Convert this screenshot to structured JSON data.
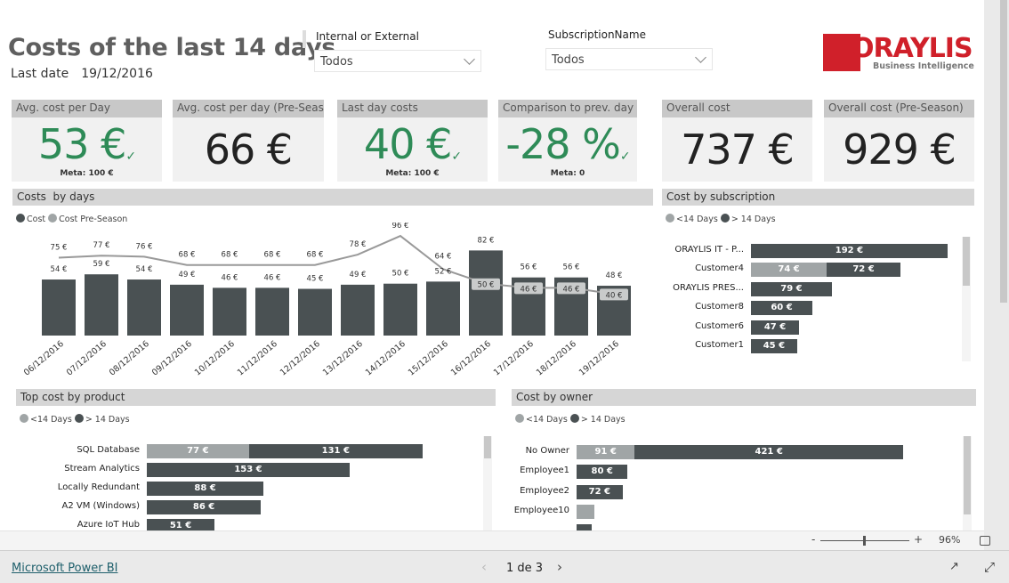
{
  "header": {
    "title": "Costs of the last 14 days",
    "last_date_label": "Last date",
    "last_date_value": "19/12/2016"
  },
  "slicers": [
    {
      "label": "Internal or External",
      "value": "Todos"
    },
    {
      "label": "SubscriptionName",
      "value": "Todos"
    }
  ],
  "logo": {
    "name": "ORAYLIS",
    "tagline": "Business Intelligence",
    "color": "#d0202a"
  },
  "kpis": [
    {
      "title": "Avg. cost per Day",
      "value": "53 €",
      "meta": "Meta: 100 €",
      "status": "good"
    },
    {
      "title": "Avg. cost per day (Pre-Season)",
      "value": "66 €"
    },
    {
      "title": "Last day costs",
      "value": "40 €",
      "meta": "Meta: 100 €",
      "status": "good"
    },
    {
      "title": "Comparison to prev. day",
      "value": "-28 %",
      "meta": "Meta: 0",
      "status": "good"
    },
    {
      "title": "Overall cost",
      "value": "737 €"
    },
    {
      "title": "Overall cost (Pre-Season)",
      "value": "929 €"
    }
  ],
  "colors": {
    "dark": "#4a5153",
    "light": "#a0a5a6",
    "good": "#2e8b57",
    "line": "#999999"
  },
  "chart_data": [
    {
      "type": "bar",
      "title": "Costs  by days",
      "legend": [
        "Cost",
        "Cost Pre-Season"
      ],
      "categories": [
        "06/12/2016",
        "07/12/2016",
        "08/12/2016",
        "09/12/2016",
        "10/12/2016",
        "11/12/2016",
        "12/12/2016",
        "13/12/2016",
        "14/12/2016",
        "15/12/2016",
        "16/12/2016",
        "17/12/2016",
        "18/12/2016",
        "19/12/2016"
      ],
      "series": [
        {
          "name": "Cost",
          "type": "bar",
          "values": [
            54,
            59,
            54,
            49,
            46,
            46,
            45,
            49,
            50,
            52,
            82,
            56,
            56,
            48
          ]
        },
        {
          "name": "Cost Pre-Season",
          "type": "line",
          "values": [
            75,
            77,
            76,
            68,
            68,
            68,
            68,
            78,
            96,
            64,
            50,
            46,
            46,
            40
          ]
        }
      ],
      "unit": "€"
    },
    {
      "type": "bar",
      "orientation": "horizontal",
      "stacked": true,
      "title": "Cost by subscription",
      "legend": [
        "<14 Days",
        "> 14 Days"
      ],
      "categories": [
        "ORAYLIS IT - P...",
        "Customer4",
        "ORAYLIS PRES...",
        "Customer8",
        "Customer6",
        "Customer1"
      ],
      "series": [
        {
          "name": "<14 Days",
          "values": [
            0,
            74,
            0,
            0,
            0,
            0
          ]
        },
        {
          "name": "> 14 Days",
          "values": [
            192,
            72,
            79,
            60,
            47,
            45
          ]
        }
      ],
      "unit": "€"
    },
    {
      "type": "bar",
      "orientation": "horizontal",
      "stacked": true,
      "title": "Top cost by product",
      "legend": [
        "<14 Days",
        "> 14 Days"
      ],
      "categories": [
        "SQL Database",
        "Stream Analytics",
        "Locally Redundant",
        "A2 VM (Windows)",
        "Azure IoT Hub"
      ],
      "series": [
        {
          "name": "<14 Days",
          "values": [
            77,
            0,
            0,
            0,
            0
          ]
        },
        {
          "name": "> 14 Days",
          "values": [
            131,
            153,
            88,
            86,
            51
          ]
        }
      ],
      "unit": "€"
    },
    {
      "type": "bar",
      "orientation": "horizontal",
      "stacked": true,
      "title": "Cost by owner",
      "legend": [
        "<14 Days",
        "> 14 Days"
      ],
      "categories": [
        "No Owner",
        "Employee1",
        "Employee2",
        "Employee10",
        ""
      ],
      "series": [
        {
          "name": "<14 Days",
          "values": [
            91,
            0,
            0,
            28,
            0
          ]
        },
        {
          "name": "> 14 Days",
          "values": [
            421,
            80,
            72,
            0,
            24
          ]
        }
      ],
      "unit": "€"
    }
  ],
  "zoom": {
    "minus": "-",
    "plus": "+",
    "level": "96%",
    "slider_fraction": 0.48
  },
  "footer": {
    "link": "Microsoft Power BI",
    "page": "1 de 3"
  }
}
